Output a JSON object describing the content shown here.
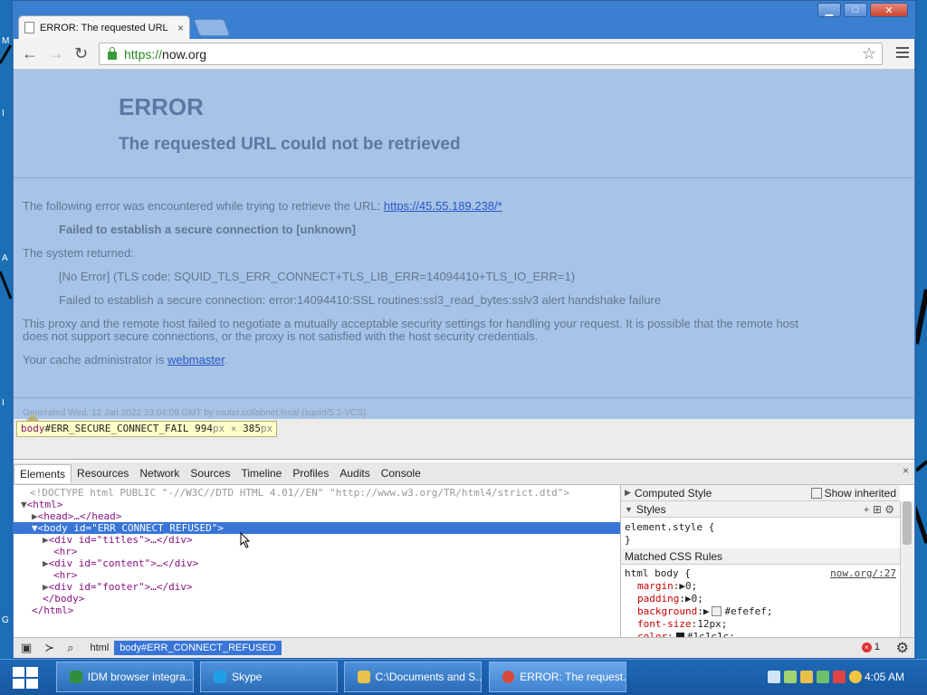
{
  "desktop": {
    "edge_letters": [
      "M",
      "I",
      "A",
      "I",
      "G"
    ]
  },
  "window": {
    "tab_title": "ERROR: The requested URL",
    "tab_close": "×",
    "controls": {
      "minimize": "▁",
      "maximize": "□",
      "close": "✕"
    }
  },
  "toolbar": {
    "back": "←",
    "forward": "→",
    "reload": "↻",
    "url_scheme": "https://",
    "url_host": "now.org",
    "star": "☆"
  },
  "page": {
    "heading": "ERROR",
    "subheading": "The requested URL could not be retrieved",
    "intro": "The following error was encountered while trying to retrieve the URL:",
    "error_url": "https://45.55.189.238/*",
    "failed_bold": "Failed to establish a secure connection to [unknown]",
    "system_returned": "The system returned:",
    "tls_code": "[No Error] (TLS code: SQUID_TLS_ERR_CONNECT+TLS_LIB_ERR=14094410+TLS_IO_ERR=1)",
    "ssl_error": "Failed to establish a secure connection: error:14094410:SSL routines:ssl3_read_bytes:sslv3 alert handshake failure",
    "proxy_msg_1": "This proxy and the remote host failed to negotiate a mutually acceptable security settings for handling your request. It is possible that the remote host",
    "proxy_msg_2": "does not support secure connections, or the proxy is not satisfied with the host security credentials.",
    "admin_prefix": "Your cache administrator is",
    "admin_link": "webmaster",
    "admin_suffix": ".",
    "generated": "Generated Wed, 12 Jan 2022 23:04:09 GMT by router.collabnet.local (squid/5.2-VCS)"
  },
  "inspect_tooltip": {
    "tag": "body",
    "selector": "#ERR_SECURE_CONNECT_FAIL",
    "width": "994",
    "height": "385",
    "unit": "px",
    "times": "×"
  },
  "devtools": {
    "tabs": [
      "Elements",
      "Resources",
      "Network",
      "Sources",
      "Timeline",
      "Profiles",
      "Audits",
      "Console"
    ],
    "close": "×",
    "dom": {
      "doctype": "<!DOCTYPE html PUBLIC \"-//W3C//DTD HTML 4.01//EN\" \"http://www.w3.org/TR/html4/strict.dtd\">",
      "html_open": "<html>",
      "head": "<head>…</head>",
      "body_tag": "<body",
      "body_attr": "id=",
      "body_val": "\"ERR_CONNECT_REFUSED\"",
      "body_close": ">",
      "div_titles": "<div id=\"titles\">…</div>",
      "hr1": "<hr>",
      "div_content": "<div id=\"content\">…</div>",
      "hr2": "<hr>",
      "div_footer": "<div id=\"footer\">…</div>",
      "body_end": "</body>",
      "html_end": "</html>"
    },
    "side": {
      "computed_style": "Computed Style",
      "show_inherited": "Show inherited",
      "styles": "Styles",
      "element_style": "element.style {",
      "element_style_close": "}",
      "matched_rules": "Matched CSS Rules",
      "rule_selector": "html body {",
      "rule_source": "now.org/:27",
      "margin_prop": "margin",
      "margin_val": "0;",
      "padding_prop": "padding",
      "padding_val": "0;",
      "background_prop": "background",
      "background_val": "#efefef;",
      "fontsize_prop": "font-size",
      "fontsize_val": "12px;",
      "color_prop": "color",
      "color_val": "#1c1c1c;"
    },
    "bottom": {
      "crumb_html": "html",
      "crumb_body": "body#ERR_CONNECT_REFUSED",
      "error_count": "1"
    }
  },
  "taskbar": {
    "items": [
      {
        "label": "IDM browser integra...",
        "icon_color": "#2f8f3f"
      },
      {
        "label": "Skype",
        "icon_color": "#1fa0e6"
      },
      {
        "label": "C:\\Documents and S...",
        "icon_color": "#e8c04a"
      },
      {
        "label": "ERROR: The request...",
        "icon_color": "#d94a3a"
      }
    ],
    "clock": "4:05 AM"
  },
  "colors": {
    "page_bg": "#a7c3e6",
    "selection": "#3875d7",
    "link": "#2a56c6"
  }
}
